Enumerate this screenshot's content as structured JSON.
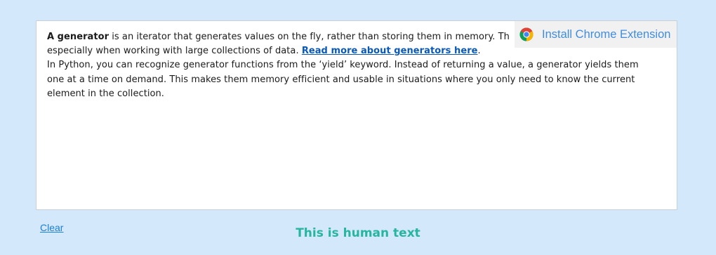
{
  "editor": {
    "line1_bold": "A generator",
    "line1_rest": " is an iterator that generates values on the fly, rather than storing them in memory. Th",
    "line2_text": "especially when working with large collections of data. ",
    "read_more_link": "Read more about generators here",
    "line2_end": ".",
    "line3": "In Python, you can recognize generator functions from the ‘yield’ keyword. Instead of returning a value, a generator yields them",
    "line4": "one at a time on demand. This makes them memory efficient and usable in situations where you only need to know the current",
    "line5": "element in the collection."
  },
  "extension_banner": {
    "label": "Install Chrome Extension",
    "icon": "chrome-icon"
  },
  "controls": {
    "clear_label": "Clear"
  },
  "result": {
    "label": "This is human text",
    "color": "#26b59e"
  },
  "colors": {
    "background": "#d3e8fb",
    "link": "#0a58b8",
    "banner_text": "#3f8de0"
  }
}
